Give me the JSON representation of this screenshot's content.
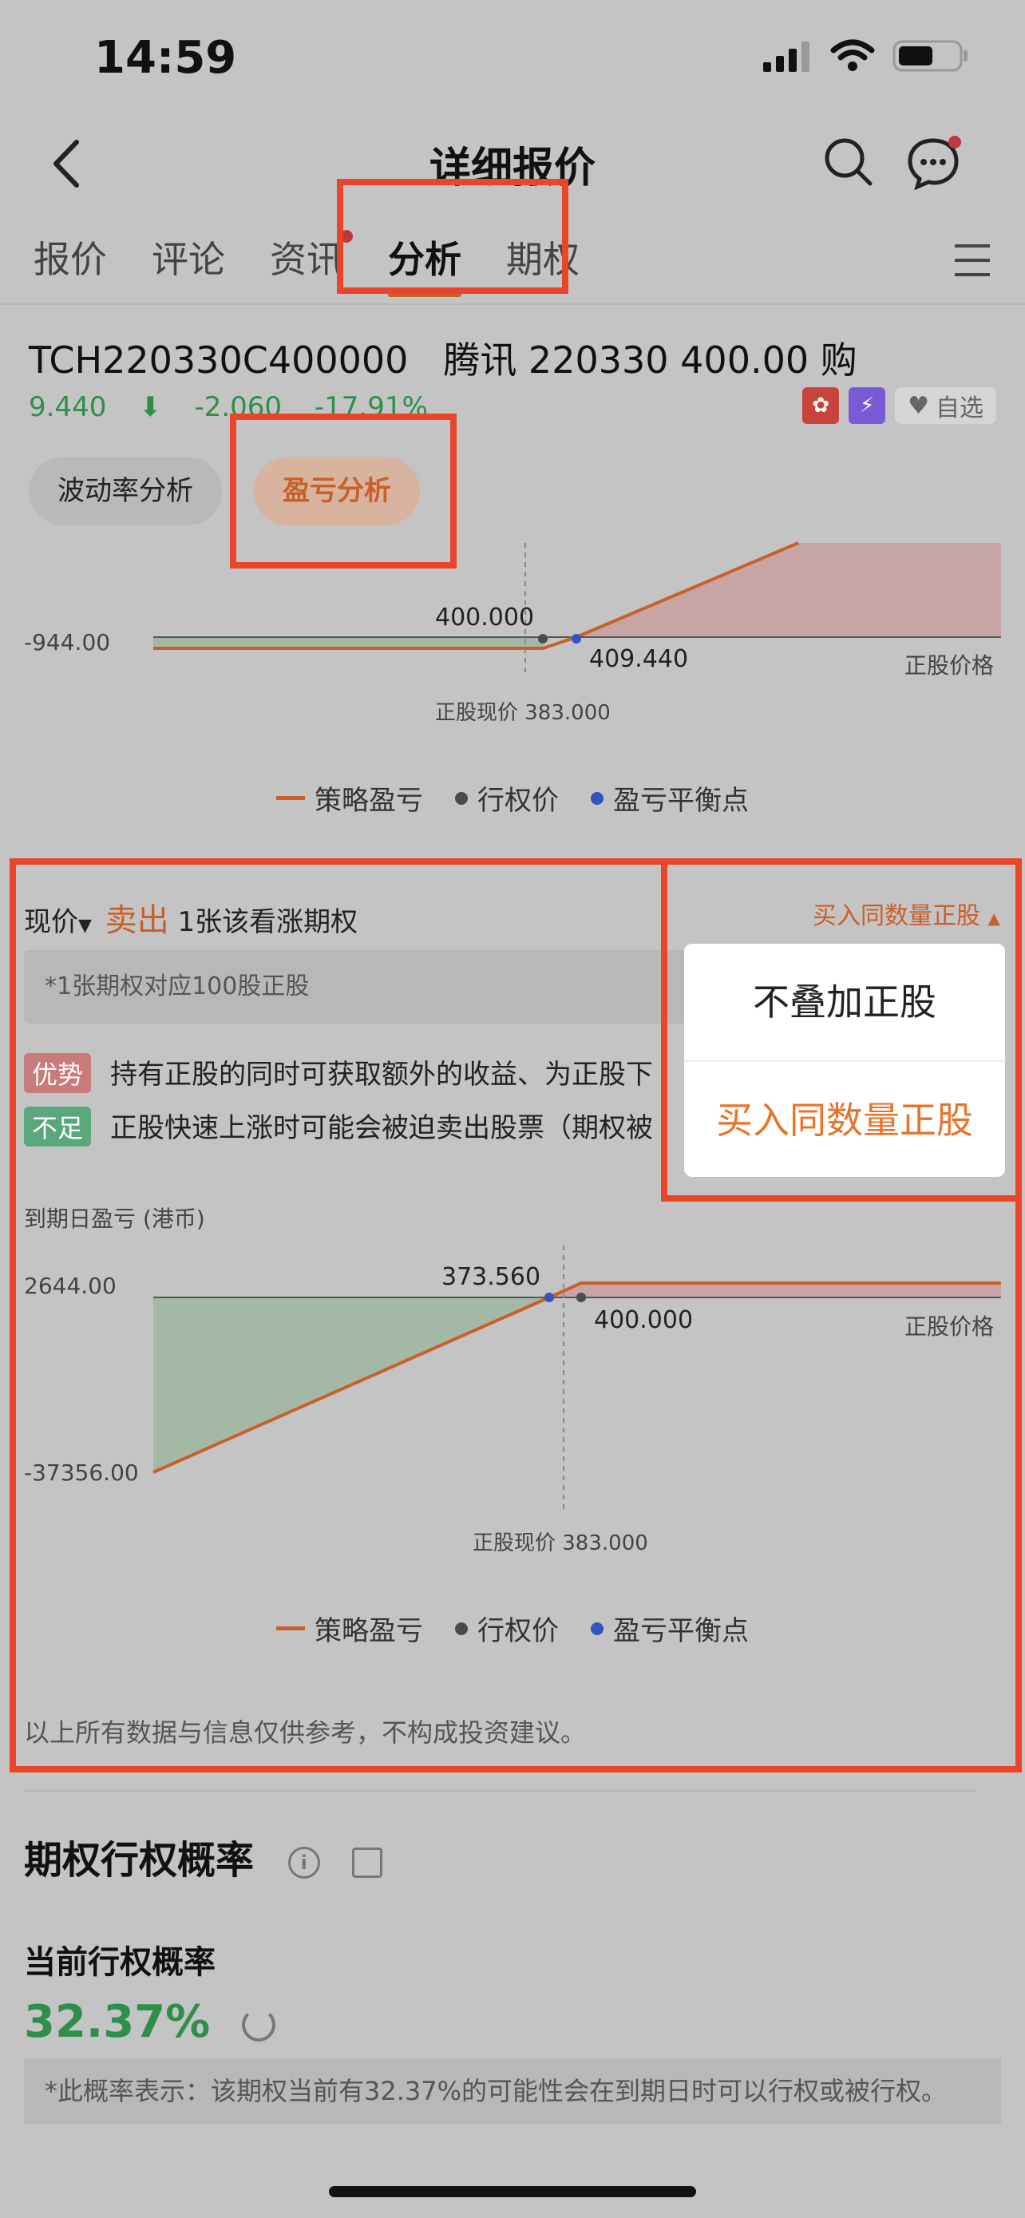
{
  "status": {
    "time": "14:59"
  },
  "header": {
    "title": "详细报价"
  },
  "tabs": [
    {
      "label": "报价",
      "active": false,
      "dot": false
    },
    {
      "label": "评论",
      "active": false,
      "dot": false
    },
    {
      "label": "资讯",
      "active": false,
      "dot": true
    },
    {
      "label": "分析",
      "active": true,
      "dot": false
    },
    {
      "label": "期权",
      "active": false,
      "dot": false
    }
  ],
  "instrument": {
    "code": "TCH220330C400000",
    "name": "腾讯 220330 400.00 购",
    "price": "9.440",
    "change": "-2.060",
    "change_pct": "-17.91%",
    "watch_label": "自选"
  },
  "analysis_pills": {
    "volatility": "波动率分析",
    "pnl": "盈亏分析"
  },
  "chart1": {
    "y_label": "-944.00",
    "strike_label": "400.000",
    "breakeven_label": "409.440",
    "x_axis_label": "正股价格",
    "spot_label": "正股现价 383.000"
  },
  "legend": {
    "strategy": "策略盈亏",
    "strike": "行权价",
    "breakeven": "盈亏平衡点"
  },
  "strategy": {
    "price_mode": "现价",
    "action": "卖出",
    "description": "1张该看涨期权",
    "hedge_selector": "买入同数量正股",
    "note": "*1张期权对应100股正股",
    "adv_tag": "优势",
    "adv_text": "持有正股的同时可获取额外的收益、为正股下",
    "dis_tag": "不足",
    "dis_text": "正股快速上涨时可能会被迫卖出股票（期权被"
  },
  "dropdown": {
    "options": [
      "不叠加正股",
      "买入同数量正股"
    ],
    "selected": "买入同数量正股"
  },
  "chart2": {
    "title": "到期日盈亏 (港币)",
    "y_max": "2644.00",
    "y_min": "-37356.00",
    "breakeven_label": "373.560",
    "strike_label": "400.000",
    "x_axis_label": "正股价格",
    "spot_label": "正股现价 383.000"
  },
  "disclaimer": "以上所有数据与信息仅供参考，不构成投资建议。",
  "exercise": {
    "section_title": "期权行权概率",
    "current_title": "当前行权概率",
    "probability": "32.37%",
    "note": "*此概率表示：该期权当前有32.37%的可能性会在到期日时可以行权或被行权。"
  },
  "colors": {
    "accent": "#c8602a",
    "up_green": "#2e8f4a",
    "highlight_red": "#e8452a",
    "strike_dot": "#4a4a55",
    "breakeven_dot": "#2e55c0"
  }
}
